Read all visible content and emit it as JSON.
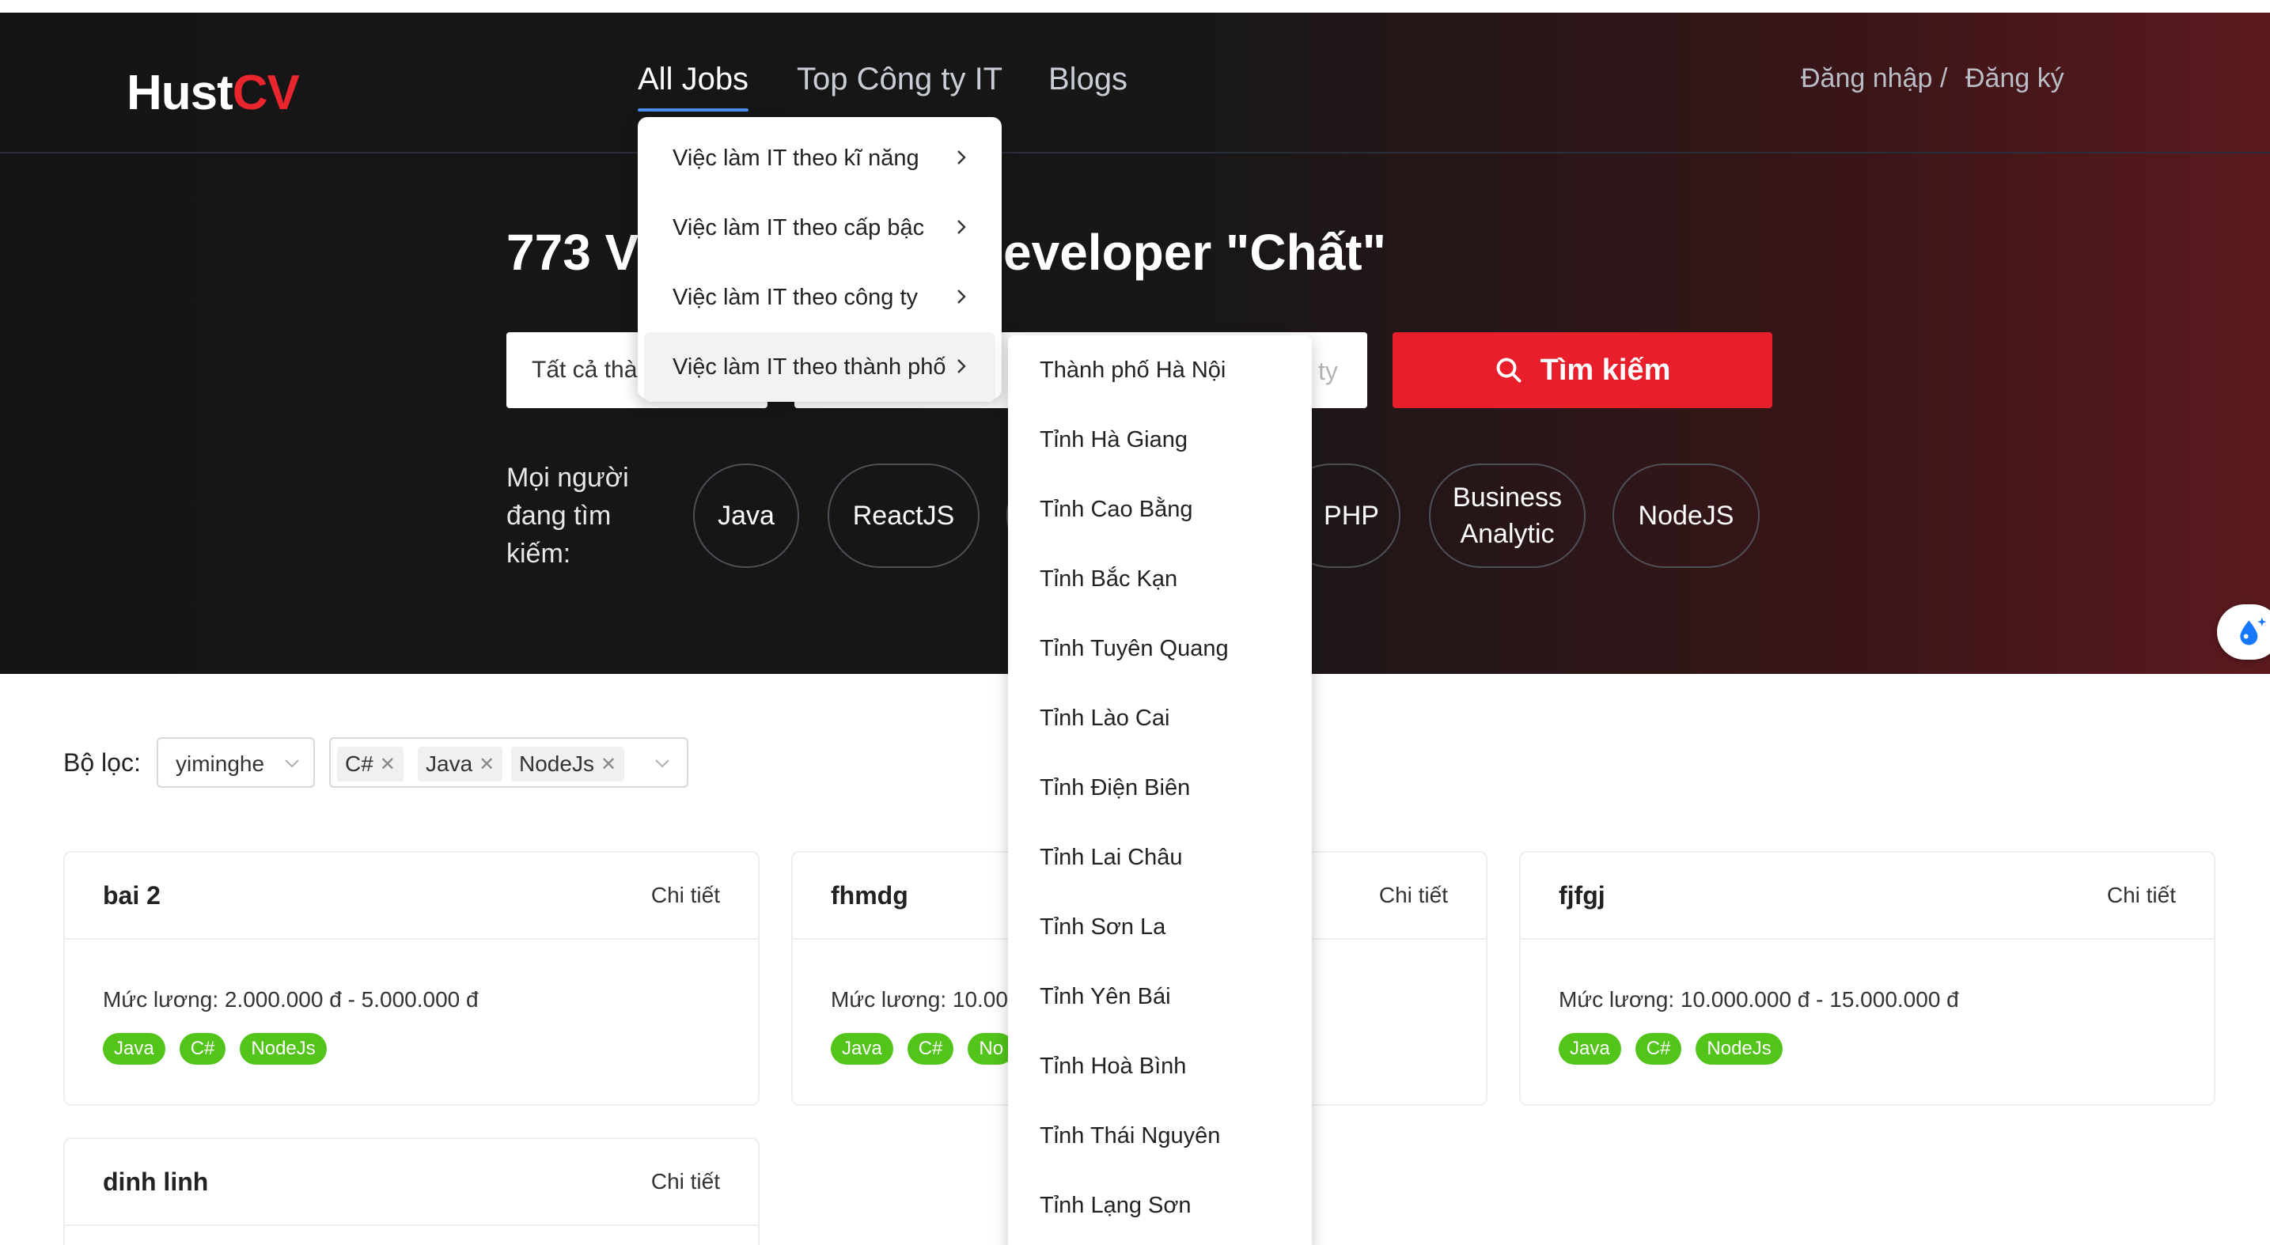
{
  "brand": {
    "name_main": "Hust",
    "name_accent": "CV"
  },
  "nav": {
    "items": [
      "All Jobs",
      "Top Công ty IT",
      "Blogs"
    ],
    "login": "Đăng nhập",
    "separator": "/",
    "register": "Đăng ký"
  },
  "hero": {
    "headline_left": "773 V",
    "headline_right": "eveloper \"Chất\"",
    "location_select": "Tất cả thàn",
    "input_placeholder_fragment": "ty",
    "search_button": "Tìm kiếm",
    "trending_label": "Mọi người đang tìm kiếm:",
    "trending": [
      "Java",
      "ReactJS",
      "PHP",
      "Business Analytic",
      "NodeJS"
    ]
  },
  "dropdown": {
    "items": [
      "Việc làm IT theo kĩ năng",
      "Việc làm IT theo cấp bậc",
      "Việc làm IT theo công ty",
      "Việc làm IT theo thành phố"
    ],
    "active_index": 3,
    "cities": [
      "Thành phố Hà Nội",
      "Tỉnh Hà Giang",
      "Tỉnh Cao Bằng",
      "Tỉnh Bắc Kạn",
      "Tỉnh Tuyên Quang",
      "Tỉnh Lào Cai",
      "Tỉnh Điện Biên",
      "Tỉnh Lai Châu",
      "Tỉnh Sơn La",
      "Tỉnh Yên Bái",
      "Tỉnh Hoà Bình",
      "Tỉnh Thái Nguyên",
      "Tỉnh Lạng Sơn"
    ]
  },
  "filter": {
    "label": "Bộ lọc:",
    "select_value": "yiminghe",
    "tags": [
      "C#",
      "Java",
      "NodeJs"
    ]
  },
  "cards": [
    {
      "title": "bai 2",
      "link": "Chi tiết",
      "salary": "Mức lương: 2.000.000 đ - 5.000.000 đ",
      "skills": [
        "Java",
        "C#",
        "NodeJs"
      ]
    },
    {
      "title": "fhmdg",
      "link": "Chi tiết",
      "salary": "Mức lương: 10.00",
      "skills": [
        "Java",
        "C#",
        "No"
      ]
    },
    {
      "title": "fjfgj",
      "link": "Chi tiết",
      "salary": "Mức lương: 10.000.000 đ - 15.000.000 đ",
      "skills": [
        "Java",
        "C#",
        "NodeJs"
      ]
    },
    {
      "title": "dinh linh",
      "link": "Chi tiết"
    }
  ],
  "colors": {
    "brand_red": "#e9252e",
    "button_red": "#e81e2a",
    "skill_green": "#52c41a",
    "nav_underline": "#4b8df6"
  }
}
